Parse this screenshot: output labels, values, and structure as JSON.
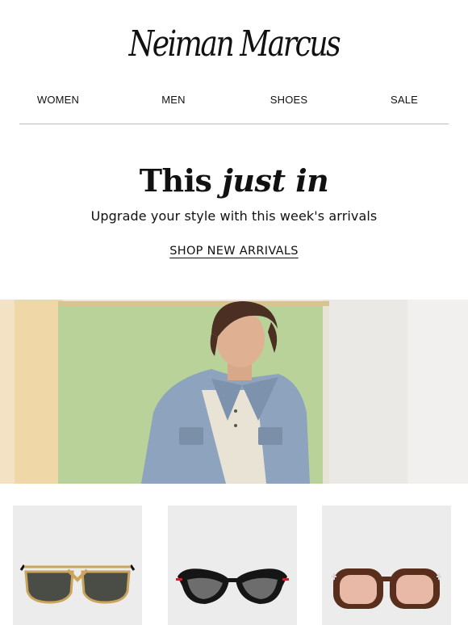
{
  "brand": {
    "logo_text": "Neiman Marcus"
  },
  "nav": {
    "items": [
      {
        "label": "WOMEN"
      },
      {
        "label": "MEN"
      },
      {
        "label": "SHOES"
      },
      {
        "label": "SALE"
      }
    ]
  },
  "promo": {
    "headline_regular": "This",
    "headline_italic": "just in",
    "subheadline": "Upgrade your style with this week's arrivals",
    "cta_label": "SHOP NEW ARRIVALS"
  },
  "hero": {
    "icon": "hero-photo-man-denim-jacket"
  },
  "products": [
    {
      "icon": "aviator-sunglasses-gold",
      "colors": {
        "frame": "#c9a45a",
        "lens": "#4a4d46"
      }
    },
    {
      "icon": "cat-eye-sunglasses-black",
      "colors": {
        "frame": "#151515",
        "lens": "#6d6d6d",
        "accent": "#c0262d"
      }
    },
    {
      "icon": "oversized-sunglasses-tortoise",
      "colors": {
        "frame": "#5a2e1c",
        "lens": "#e8b9a6"
      }
    }
  ]
}
